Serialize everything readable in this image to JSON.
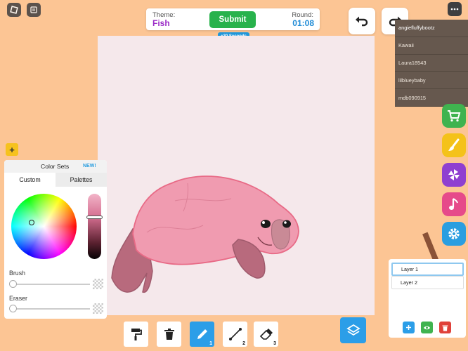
{
  "header": {
    "theme_label": "Theme:",
    "theme_value": "Fish",
    "submit_label": "Submit",
    "round_label": "Round:",
    "round_value": "01:08",
    "bonus_label": "+30 Seconds"
  },
  "players": [
    "angiefluffybootz",
    "Kawaii",
    "Laura18543",
    "lilblueybaby",
    "mdb090915"
  ],
  "side_buttons": [
    {
      "name": "shop-button",
      "color": "#3fb34f",
      "icon": "cart-icon"
    },
    {
      "name": "paint-button",
      "color": "#f4c21a",
      "icon": "paintbrush-icon"
    },
    {
      "name": "spin-button",
      "color": "#8f3fd0",
      "icon": "pinwheel-icon"
    },
    {
      "name": "music-button",
      "color": "#e64a8a",
      "icon": "music-note-icon"
    },
    {
      "name": "settings-button",
      "color": "#2a9ee0",
      "icon": "gear-icon"
    }
  ],
  "color_panel": {
    "title": "Color Sets",
    "new_badge": "NEW!",
    "tabs": [
      "Custom",
      "Palettes"
    ],
    "selected_tab": "Custom",
    "brush_label": "Brush",
    "eraser_label": "Eraser",
    "brush_size": 0,
    "eraser_size": 0
  },
  "tools": [
    {
      "name": "bucket-tool",
      "icon": "paint-roller-icon",
      "number": ""
    },
    {
      "name": "trash-tool",
      "icon": "trash-icon",
      "number": ""
    },
    {
      "name": "pencil-tool",
      "icon": "pencil-icon",
      "number": "1",
      "active": true
    },
    {
      "name": "line-tool",
      "icon": "line-icon",
      "number": "2"
    },
    {
      "name": "eraser-tool",
      "icon": "eraser-icon",
      "number": "3"
    }
  ],
  "layers": {
    "items": [
      "Layer 1",
      "Layer 2"
    ],
    "selected": "Layer 1",
    "colors": {
      "add": "#2b9ee8",
      "view": "#3fb34f",
      "delete": "#e0413a"
    }
  }
}
